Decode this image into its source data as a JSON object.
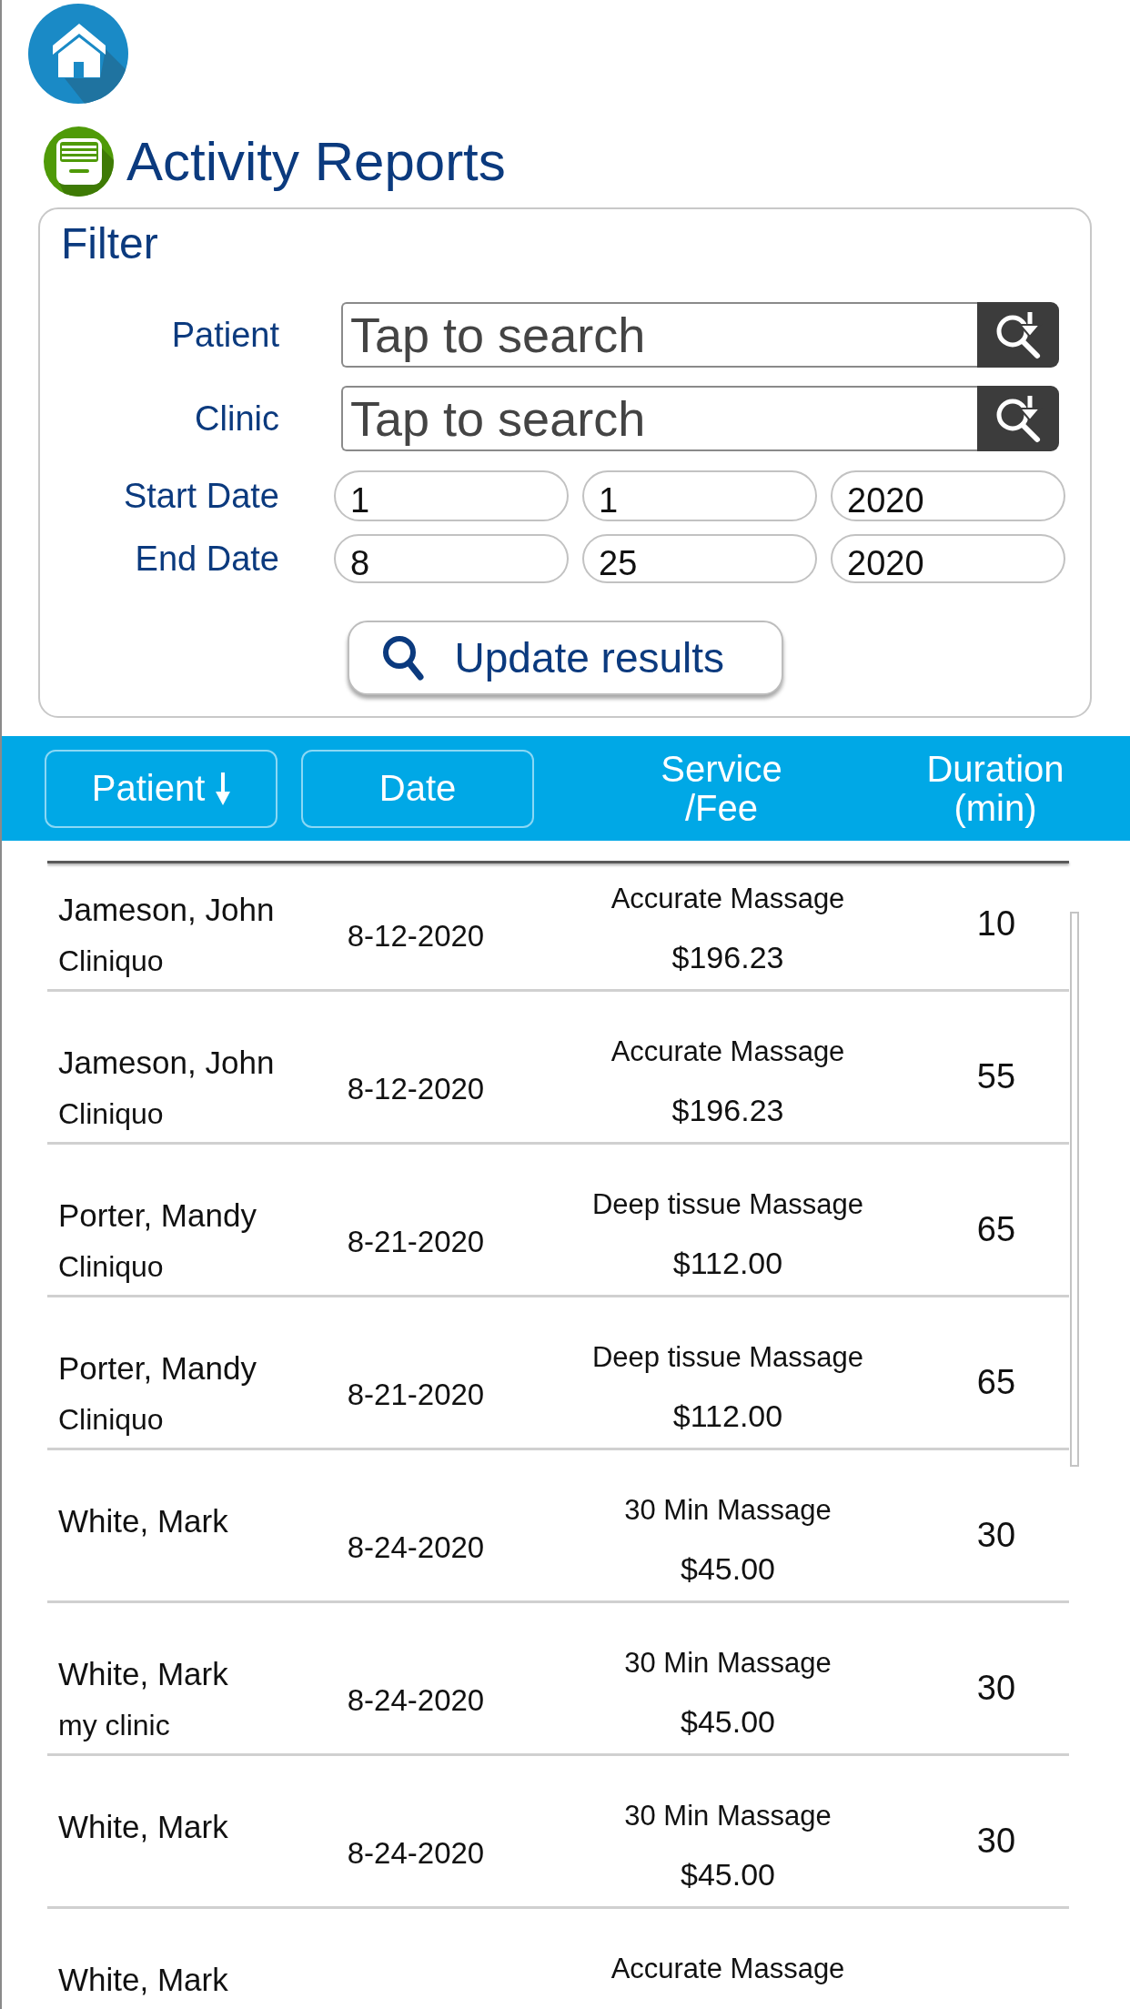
{
  "page_title": "Activity Reports",
  "filter": {
    "title": "Filter",
    "search_fields": [
      {
        "label": "Patient",
        "placeholder": "Tap to search"
      },
      {
        "label": "Clinic",
        "placeholder": "Tap to search"
      }
    ],
    "date_fields": [
      {
        "label": "Start Date",
        "values": [
          "1",
          "1",
          "2020"
        ]
      },
      {
        "label": "End Date",
        "values": [
          "8",
          "25",
          "2020"
        ]
      }
    ],
    "update_button": "Update results"
  },
  "table": {
    "columns": [
      {
        "kind": "button",
        "lines": [
          "Patient"
        ],
        "sorted": true
      },
      {
        "kind": "button",
        "lines": [
          "Date"
        ],
        "sorted": false
      },
      {
        "kind": "text",
        "lines": [
          "Service",
          "/Fee"
        ]
      },
      {
        "kind": "text",
        "lines": [
          "Duration",
          "(min)"
        ]
      }
    ],
    "rows": [
      {
        "patient": "Jameson, John",
        "clinic": "Cliniquo",
        "date": "8-12-2020",
        "service": "Accurate Massage",
        "fee": "$196.23",
        "duration": "10"
      },
      {
        "patient": "Jameson, John",
        "clinic": "Cliniquo",
        "date": "8-12-2020",
        "service": "Accurate Massage",
        "fee": "$196.23",
        "duration": "55"
      },
      {
        "patient": "Porter, Mandy",
        "clinic": "Cliniquo",
        "date": "8-21-2020",
        "service": "Deep tissue Massage",
        "fee": "$112.00",
        "duration": "65"
      },
      {
        "patient": "Porter, Mandy",
        "clinic": "Cliniquo",
        "date": "8-21-2020",
        "service": "Deep tissue Massage",
        "fee": "$112.00",
        "duration": "65"
      },
      {
        "patient": "White, Mark",
        "date": "8-24-2020",
        "service": "30 Min Massage",
        "fee": "$45.00",
        "duration": "30"
      },
      {
        "patient": "White, Mark",
        "clinic": "my clinic",
        "date": "8-24-2020",
        "service": "30 Min Massage",
        "fee": "$45.00",
        "duration": "30"
      },
      {
        "patient": "White, Mark",
        "date": "8-24-2020",
        "service": "30 Min Massage",
        "fee": "$45.00",
        "duration": "30"
      },
      {
        "patient": "White, Mark",
        "service": "Accurate Massage"
      }
    ]
  }
}
